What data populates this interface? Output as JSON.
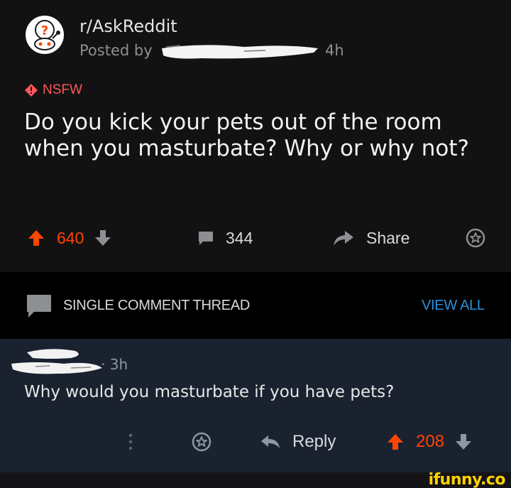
{
  "post": {
    "subreddit": "r/AskReddit",
    "posted_by_label": "Posted by",
    "age": "4h",
    "nsfw_label": "NSFW",
    "title": "Do you kick your pets out of the room when you masturbate? Why or why not?",
    "upvotes": "640",
    "comments": "344",
    "share_label": "Share"
  },
  "thread_bar": {
    "label": "SINGLE COMMENT THREAD",
    "view_all": "VIEW ALL"
  },
  "comment": {
    "age": "· 3h",
    "body": "Why would you masturbate if you have pets?",
    "reply_label": "Reply",
    "score": "208"
  },
  "watermark": "ifunny.co",
  "colors": {
    "background": "#121213",
    "upvote": "#ff4500",
    "nsfw": "#ff585b",
    "link": "#2b90d9",
    "comment_bg": "#1a2230",
    "watermark": "#ffd200"
  },
  "icons": [
    "askreddit-icon",
    "nsfw-icon",
    "upvote-icon",
    "downvote-icon",
    "comment-icon",
    "share-icon",
    "award-icon",
    "thread-icon",
    "more-icon",
    "reply-icon"
  ]
}
